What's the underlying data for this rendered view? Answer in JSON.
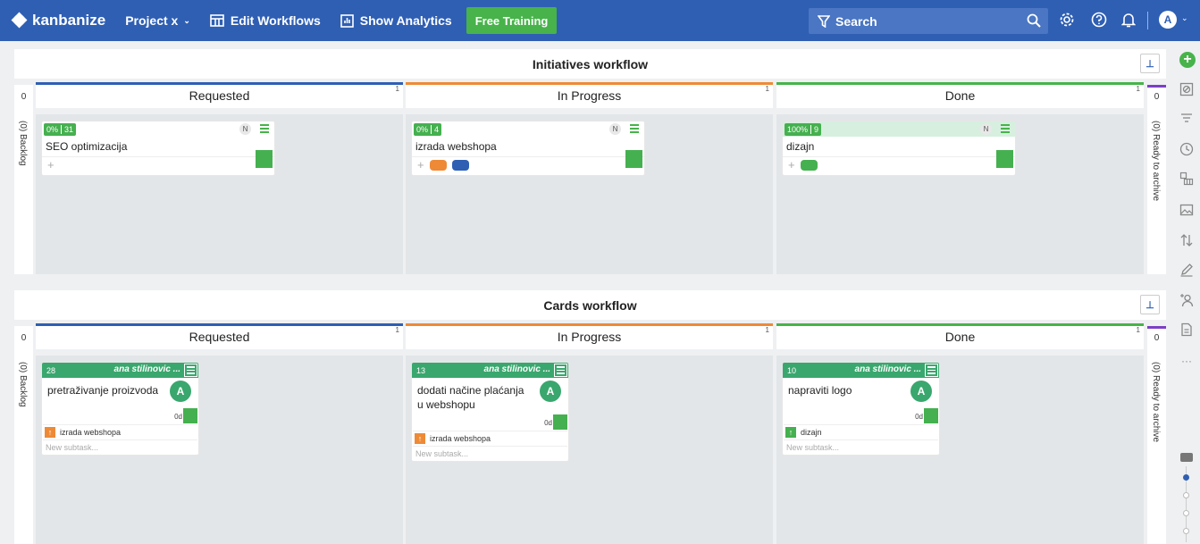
{
  "topbar": {
    "logo": "kanbanize",
    "project": "Project x",
    "edit_workflows": "Edit Workflows",
    "show_analytics": "Show Analytics",
    "free_training": "Free Training",
    "search_placeholder": "Search",
    "user_initial": "A",
    "colors": {
      "bar": "#2f5fb3",
      "training": "#47b34a"
    }
  },
  "initiatives": {
    "title": "Initiatives workflow",
    "left_count": "0",
    "right_count": "0",
    "backlog_label": "(0) Backlog",
    "archive_label": "(0) Ready to archive",
    "columns": [
      {
        "name": "Requested",
        "wip": "1",
        "color": "#2f5fb3"
      },
      {
        "name": "In Progress",
        "wip": "1",
        "color": "#ee8a36"
      },
      {
        "name": "Done",
        "wip": "1",
        "color": "#47b34a"
      }
    ],
    "cards": [
      {
        "percent": "0%",
        "id": "31",
        "initial": "N",
        "title": "SEO optimizacija",
        "plus": "+"
      },
      {
        "percent": "0%",
        "id": "4",
        "initial": "N",
        "title": "izrada webshopa",
        "plus": "+"
      },
      {
        "percent": "100%",
        "id": "9",
        "initial": "N",
        "title": "dizajn",
        "plus": "+"
      }
    ]
  },
  "cards_wf": {
    "title": "Cards workflow",
    "left_count": "0",
    "right_count": "0",
    "backlog_label": "(0) Backlog",
    "archive_label": "(0) Ready to archive",
    "columns": [
      {
        "name": "Requested",
        "wip": "1",
        "color": "#2f5fb3"
      },
      {
        "name": "In Progress",
        "wip": "1",
        "color": "#ee8a36"
      },
      {
        "name": "Done",
        "wip": "1",
        "color": "#47b34a"
      }
    ],
    "cards": [
      {
        "id": "28",
        "owner": "ana stilinovic ...",
        "title": "pretraživanje proizvoda",
        "avatar": "A",
        "time": "0d",
        "parent_arrow": "↑",
        "parent": "izrada webshopa",
        "parent_color": "#ee8a36",
        "subtask": "New subtask..."
      },
      {
        "id": "13",
        "owner": "ana stilinovic ...",
        "title": "dodati načine plaćanja u webshopu",
        "avatar": "A",
        "time": "0d",
        "parent_arrow": "↑",
        "parent": "izrada webshopa",
        "parent_color": "#ee8a36",
        "subtask": "New subtask..."
      },
      {
        "id": "10",
        "owner": "ana stilinovic ...",
        "title": "napraviti logo",
        "avatar": "A",
        "time": "0d",
        "parent_arrow": "↑",
        "parent": "dizajn",
        "parent_color": "#45b04f",
        "subtask": "New subtask..."
      }
    ]
  },
  "rail": {
    "add": "+",
    "more": "···",
    "icons": [
      "archive-icon",
      "filter-icon",
      "clock-icon",
      "swimlane-icon",
      "image-icon",
      "sort-icon",
      "edit-icon",
      "add-user-icon",
      "document-icon"
    ]
  }
}
